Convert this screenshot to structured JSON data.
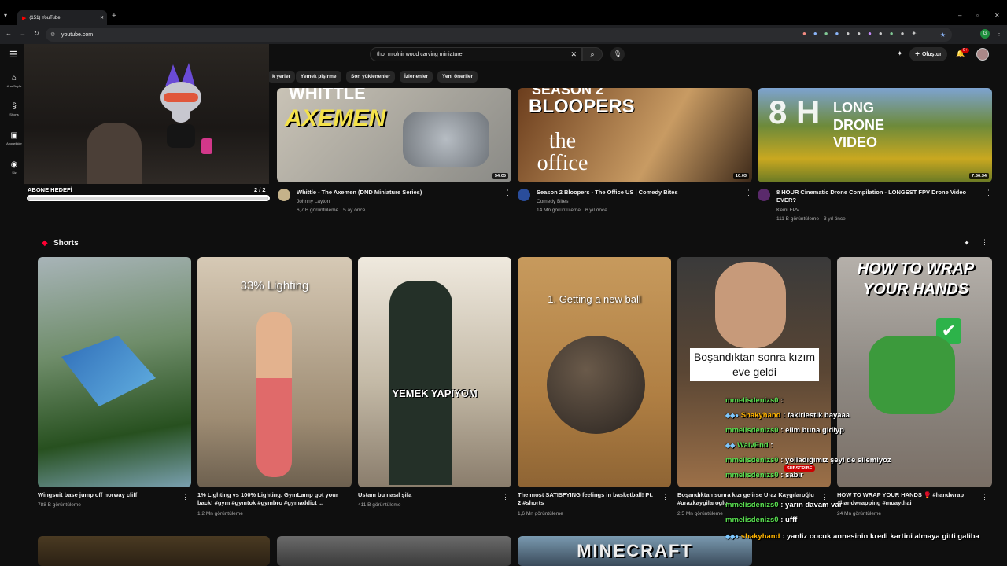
{
  "browser": {
    "tab_title": "(151) YouTube",
    "url": "youtube.com"
  },
  "youtube": {
    "search_value": "thor mjolnir wood carving miniature",
    "create_label": "Oluştur",
    "notif_count": "9+",
    "sidebar": [
      {
        "icon": "home-icon",
        "label": "Ana Sayfa"
      },
      {
        "icon": "shorts-icon",
        "label": "Shorts"
      },
      {
        "icon": "subscriptions-icon",
        "label": "Abonelikler"
      },
      {
        "icon": "you-icon",
        "label": "Siz"
      }
    ],
    "chips": [
      "k yerler",
      "Yemek pişirme",
      "Son yüklenenler",
      "İzlenenler",
      "Yeni öneriler"
    ],
    "videos": [
      {
        "title": "Whittle - The Axemen (DND Miniature Series)",
        "channel": "Johnny Layton",
        "views": "6,7 B görüntüleme",
        "age": "5 ay önce",
        "duration": "54:05",
        "thumb_text1": "WHITTLE",
        "thumb_text2": "AXEMEN"
      },
      {
        "title": "Season 2 Bloopers - The Office US | Comedy Bites",
        "channel": "Comedy Bites",
        "views": "14 Mn görüntüleme",
        "age": "6 yıl önce",
        "duration": "10:03",
        "thumb_text1": "SEASON 2",
        "thumb_text2": "BLOOPERS",
        "thumb_text3": "the office"
      },
      {
        "title": "8 HOUR Cinematic Drone Compilation - LONGEST FPV Drone Video EVER?",
        "channel": "Kemi FPV",
        "views": "111 B görüntüleme",
        "age": "3 yıl önce",
        "duration": "7:56:34",
        "thumb_text1": "8 H",
        "thumb_text2": "LONG",
        "thumb_text3": "DRONE",
        "thumb_text4": "VIDEO"
      }
    ],
    "shorts_header": "Shorts",
    "shorts": [
      {
        "title": "Wingsuit base jump off norway cliff",
        "views": "788 B görüntüleme",
        "overlay": ""
      },
      {
        "title": "1% Lighting vs 100% Lighting. GymLamp got your back! #gym #gymtok #gymbro #gymaddict ...",
        "views": "1,2 Mn görüntüleme",
        "overlay": "33% Lighting"
      },
      {
        "title": "Ustam bu nasıl şifa",
        "views": "411 B görüntüleme",
        "overlay": "YEMEK YAPIYOM"
      },
      {
        "title": "The most SATISFYING feelings in basketball! Pt. 2 #shorts",
        "views": "1,6 Mn görüntüleme",
        "overlay": "1. Getting a new ball"
      },
      {
        "title": "Boşandıktan sonra kızı gelirse Uraz Kaygılaroğlu #urazkaygilaroglu",
        "views": "2,5 Mn görüntüleme",
        "overlay": "Boşandıktan sonra kızım eve geldi"
      },
      {
        "title": "HOW TO WRAP YOUR HANDS 🥊 #handwrap #handwrapping #muaythai",
        "views": "24 Mn görüntüleme",
        "overlay": "HOW TO WRAP YOUR HANDS"
      }
    ],
    "bottom_thumb_text": "MINECRAFT"
  },
  "stream": {
    "goal_label": "ABONE HEDEFİ",
    "goal_count": "2 / 2",
    "chat": [
      {
        "user": "mmelisdenizs0",
        "msg": ":"
      },
      {
        "user": "Shakyhand",
        "msg": ": fakirlestik bayaaa"
      },
      {
        "user": "mmelisdenizs0",
        "msg": ": elim buna gidiyp"
      },
      {
        "user": "WaivEnd",
        "msg": ":"
      },
      {
        "user": "mmelisdenizs0",
        "msg": ": yolladığımız şeyi de silemiyoz"
      },
      {
        "user": "mmelisdenizs0",
        "msg": ": sabır"
      },
      {
        "user": "mmelisdenizs0",
        "msg": ": yarın davam var"
      },
      {
        "user": "mmelisdenizs0",
        "msg": ": ufff"
      },
      {
        "user": "shakyhand",
        "msg": ": yanliz cocuk annesinin kredi kartini almaya gitti galiba"
      }
    ],
    "subscribe_label": "SUBSCRIBE"
  }
}
